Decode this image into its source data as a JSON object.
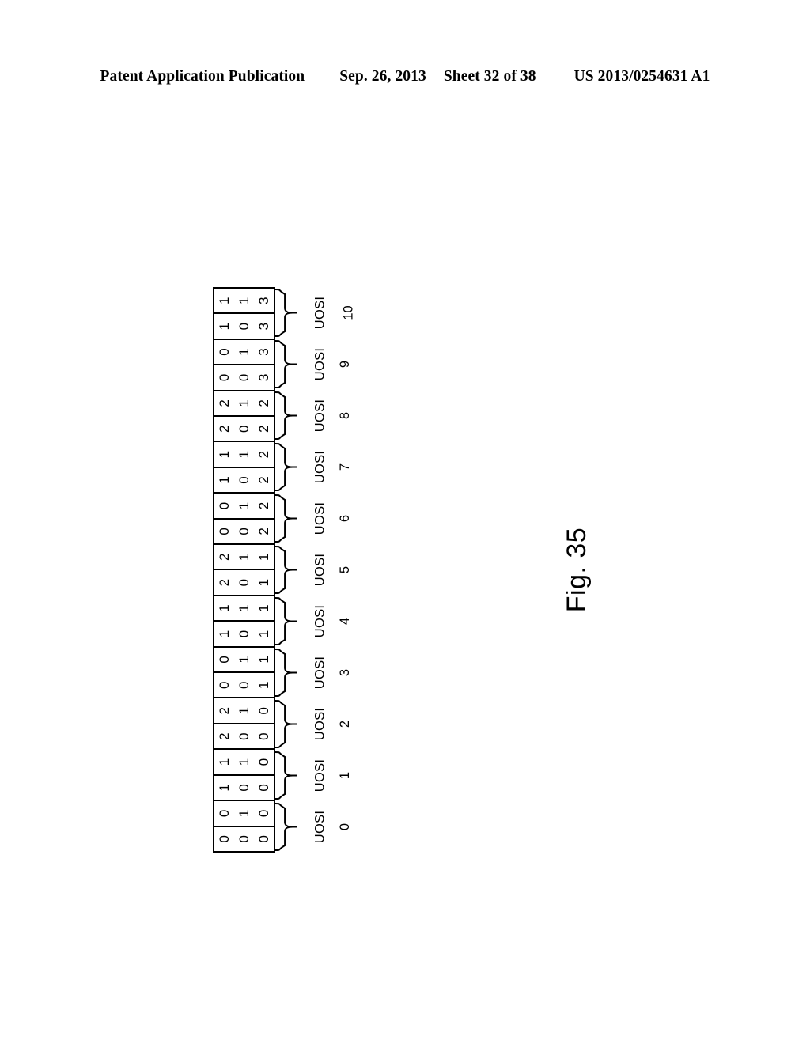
{
  "header": {
    "publication": "Patent Application Publication",
    "date": "Sep. 26, 2013",
    "sheet": "Sheet 32 of 38",
    "patent_number": "US 2013/0254631 A1"
  },
  "figure": {
    "caption": "Fig. 35",
    "label_prefix": "UOSI",
    "column_count": 3,
    "groups": [
      {
        "label": "UOSI",
        "number": "10",
        "rows": [
          [
            "1",
            "1",
            "3"
          ],
          [
            "1",
            "0",
            "3"
          ]
        ]
      },
      {
        "label": "UOSI",
        "number": "9",
        "rows": [
          [
            "0",
            "1",
            "3"
          ],
          [
            "0",
            "0",
            "3"
          ]
        ]
      },
      {
        "label": "UOSI",
        "number": "8",
        "rows": [
          [
            "2",
            "1",
            "2"
          ],
          [
            "2",
            "0",
            "2"
          ]
        ]
      },
      {
        "label": "UOSI",
        "number": "7",
        "rows": [
          [
            "1",
            "1",
            "2"
          ],
          [
            "1",
            "0",
            "2"
          ]
        ]
      },
      {
        "label": "UOSI",
        "number": "6",
        "rows": [
          [
            "0",
            "1",
            "2"
          ],
          [
            "0",
            "0",
            "2"
          ]
        ]
      },
      {
        "label": "UOSI",
        "number": "5",
        "rows": [
          [
            "2",
            "1",
            "1"
          ],
          [
            "2",
            "0",
            "1"
          ]
        ]
      },
      {
        "label": "UOSI",
        "number": "4",
        "rows": [
          [
            "1",
            "1",
            "1"
          ],
          [
            "1",
            "0",
            "1"
          ]
        ]
      },
      {
        "label": "UOSI",
        "number": "3",
        "rows": [
          [
            "0",
            "1",
            "1"
          ],
          [
            "0",
            "0",
            "1"
          ]
        ]
      },
      {
        "label": "UOSI",
        "number": "2",
        "rows": [
          [
            "2",
            "1",
            "0"
          ],
          [
            "2",
            "0",
            "0"
          ]
        ]
      },
      {
        "label": "UOSI",
        "number": "1",
        "rows": [
          [
            "1",
            "1",
            "0"
          ],
          [
            "1",
            "0",
            "0"
          ]
        ]
      },
      {
        "label": "UOSI",
        "number": "0",
        "rows": [
          [
            "0",
            "1",
            "0"
          ],
          [
            "0",
            "0",
            "0"
          ]
        ]
      }
    ]
  }
}
